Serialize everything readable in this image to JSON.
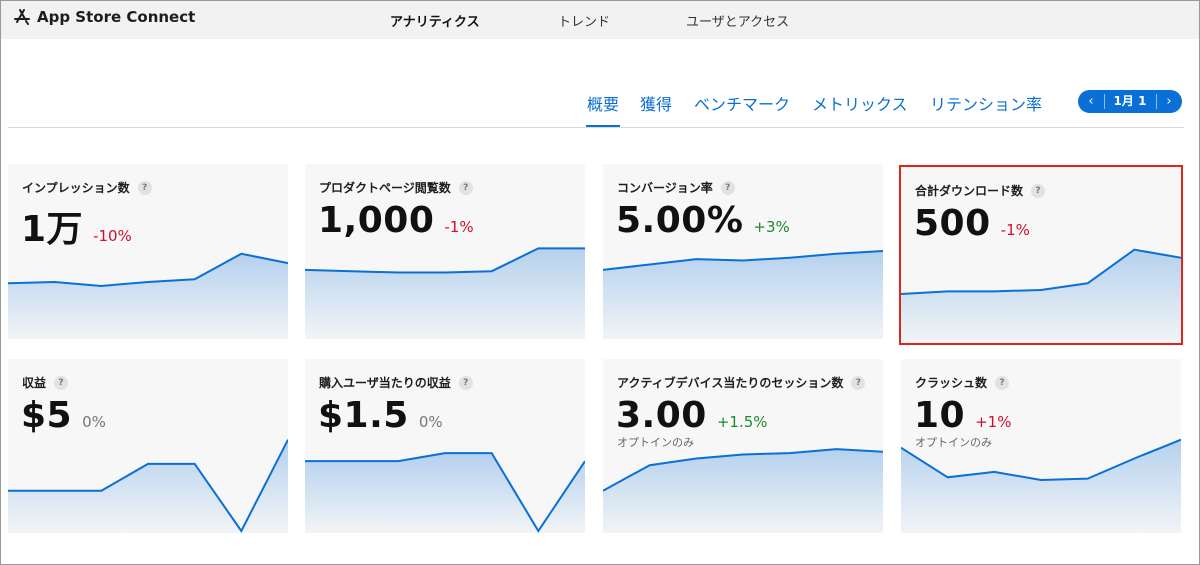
{
  "app": {
    "name": "App Store Connect"
  },
  "top_nav": [
    {
      "label": "アナリティクス",
      "active": true
    },
    {
      "label": "トレンド",
      "active": false
    },
    {
      "label": "ユーザとアクセス",
      "active": false
    }
  ],
  "sub_tabs": [
    {
      "label": "概要",
      "active": true
    },
    {
      "label": "獲得",
      "active": false
    },
    {
      "label": "ベンチマーク",
      "active": false
    },
    {
      "label": "メトリックス",
      "active": false
    },
    {
      "label": "リテンション率",
      "active": false
    }
  ],
  "date_picker": {
    "prev": "‹",
    "label": "1月 1",
    "next": "›"
  },
  "help_glyph": "?",
  "colors": {
    "accent": "#0a6fd6",
    "negative": "#d0102f",
    "positive": "#1e8a2e",
    "highlight_border": "#e1251b"
  },
  "cards": [
    {
      "title": "インプレッション数",
      "value": "1万",
      "change": "-10%",
      "change_tone": "neg",
      "note": "",
      "trend": [
        30,
        31,
        28,
        31,
        33,
        52,
        45
      ],
      "highlighted": false
    },
    {
      "title": "プロダクトページ閲覧数",
      "value": "1,000",
      "change": "-1%",
      "change_tone": "neg",
      "note": "",
      "trend": [
        40,
        39,
        38,
        38,
        39,
        56,
        56
      ],
      "highlighted": false
    },
    {
      "title": "コンバージョン率",
      "value": "5.00%",
      "change": "+3%",
      "change_tone": "pos",
      "note": "",
      "trend": [
        40,
        44,
        48,
        47,
        49,
        52,
        54
      ],
      "highlighted": false
    },
    {
      "title": "合計ダウンロード数",
      "value": "500",
      "change": "-1%",
      "change_tone": "neg",
      "note": "",
      "trend": [
        25,
        27,
        27,
        28,
        33,
        58,
        52
      ],
      "highlighted": true
    },
    {
      "title": "収益",
      "value": "$5",
      "change": "0%",
      "change_tone": "neutral",
      "note": "",
      "trend": [
        20,
        20,
        20,
        40,
        40,
        -10,
        58
      ],
      "highlighted": false
    },
    {
      "title": "購入ユーザ当たりの収益",
      "value": "$1.5",
      "change": "0%",
      "change_tone": "neutral",
      "note": "",
      "trend": [
        42,
        42,
        42,
        48,
        48,
        -10,
        42
      ],
      "highlighted": false
    },
    {
      "title": "アクティブデバイス当たりのセッション数",
      "value": "3.00",
      "change": "+1.5%",
      "change_tone": "pos",
      "note": "オプトインのみ",
      "trend": [
        20,
        39,
        44,
        47,
        48,
        51,
        49
      ],
      "highlighted": false
    },
    {
      "title": "クラッシュ数",
      "value": "10",
      "change": "+1%",
      "change_tone": "neg",
      "note": "オプトインのみ",
      "trend": [
        52,
        30,
        34,
        28,
        29,
        44,
        58
      ],
      "highlighted": false
    }
  ]
}
